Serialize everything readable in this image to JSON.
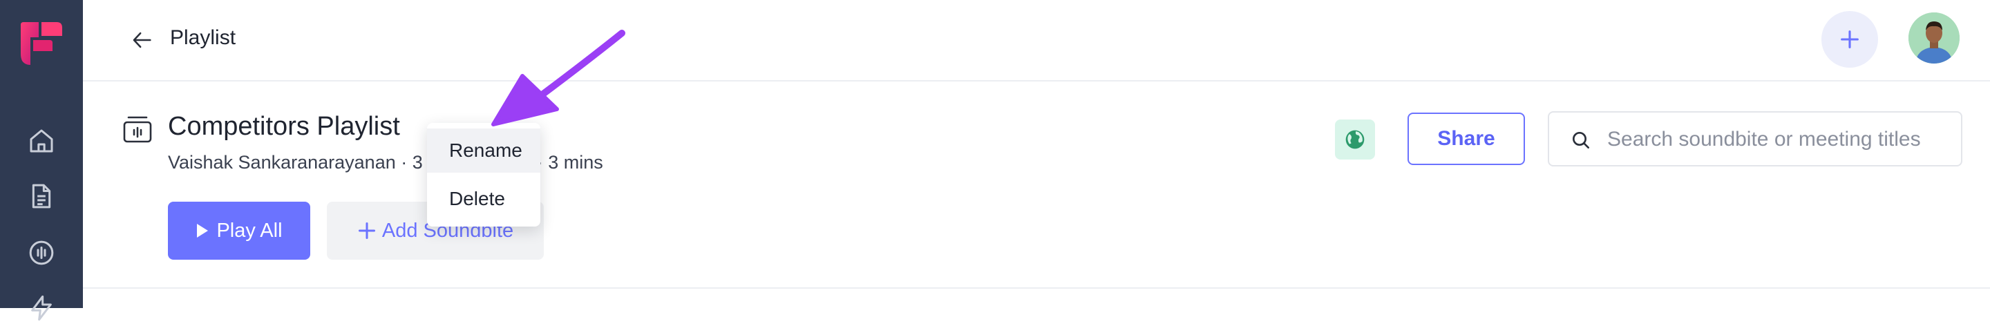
{
  "sidebar": {
    "logo": "brand-logo",
    "items": [
      {
        "icon": "home-icon"
      },
      {
        "icon": "document-icon"
      },
      {
        "icon": "soundbite-icon"
      },
      {
        "icon": "lightning-icon"
      }
    ]
  },
  "header": {
    "back_icon": "arrow-left-icon",
    "title": "Playlist",
    "add_icon": "plus-icon"
  },
  "playlist": {
    "icon": "playlist-icon",
    "title": "Competitors Playlist",
    "meta_owner": "Vaishak Sankaranarayanan · 3",
    "meta_duration": "· 3 mins",
    "play_all_label": "Play All",
    "add_soundbite_label": "Add Soundbite"
  },
  "actions": {
    "visibility_icon": "globe-icon",
    "share_label": "Share",
    "search_placeholder": "Search soundbite or meeting titles"
  },
  "context_menu": {
    "items": [
      "Rename",
      "Delete"
    ],
    "hovered": "Rename"
  },
  "colors": {
    "sidebar": "#2f3a52",
    "accent": "#6b73ff",
    "annotation_arrow": "#9b3ff5",
    "globe_bg": "#d9f5ea"
  }
}
